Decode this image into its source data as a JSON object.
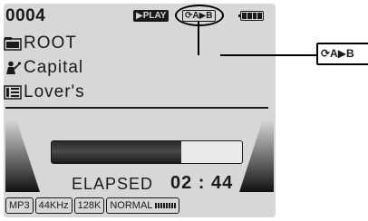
{
  "header": {
    "track_number": "0004",
    "play_status": "▶PLAY",
    "repeat_mode": "⟳A▶B"
  },
  "browser": {
    "folder": "ROOT",
    "artist": "Capital",
    "title": "Lover's"
  },
  "playback": {
    "progress_fraction": 0.68,
    "elapsed_label": "ELAPSED",
    "elapsed_time": "02 : 44"
  },
  "status_bar": {
    "format": "MP3",
    "sample_rate": "44KHz",
    "bitrate": "128K",
    "eq_mode": "NORMAL"
  },
  "callout": {
    "label": "⟳A▶B"
  },
  "icons": {
    "folder": "folder-icon",
    "artist": "artist-icon",
    "title": "song-title-icon",
    "battery": "battery-icon"
  }
}
